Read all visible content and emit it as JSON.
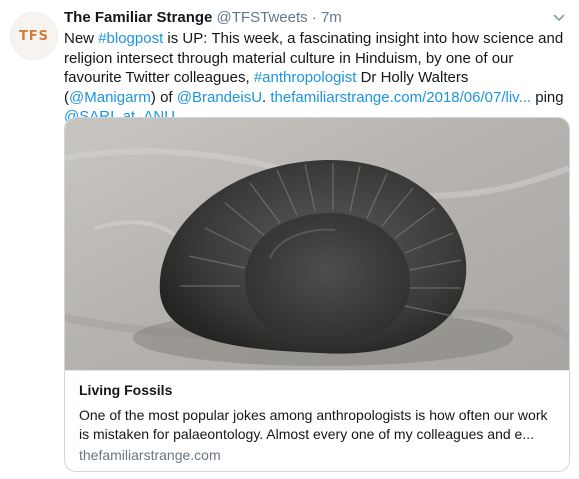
{
  "tweet": {
    "avatar_text": "TFS",
    "name": "The Familiar Strange",
    "handle": "@TFSTweets",
    "separator": "·",
    "time": "7m",
    "icons": {
      "caret": "chevron-down-icon"
    },
    "text": {
      "p1": "New ",
      "l1": "#blogpost",
      "p2": " is UP: This week, a fascinating insight into how science and religion intersect through material culture in Hinduism, by one of our favourite Twitter colleagues, ",
      "l2": "#anthropologist",
      "p3": " Dr Holly Walters (",
      "l3": "@Manigarm",
      "p4": ") of ",
      "l4": "@BrandeisU",
      "p5": ". ",
      "l5": "thefamiliarstrange.com/2018/06/07/liv...",
      "p6": " ping ",
      "l6": "@SARI_at_ANU"
    },
    "card": {
      "title": "Living Fossils",
      "description": "One of the most popular jokes among anthropologists is how often our work is mistaken for palaeontology. Almost every one of my colleagues and e...",
      "url": "thefamiliarstrange.com"
    }
  },
  "colors": {
    "link": "#1b95e0",
    "secondary_text": "#657786",
    "border": "#ccd6dd",
    "avatar_accent": "#d17c3b"
  }
}
